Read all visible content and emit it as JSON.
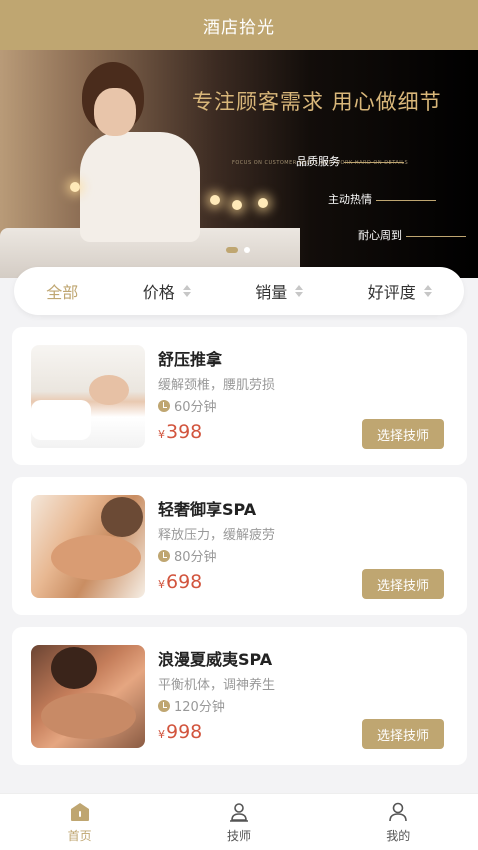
{
  "header": {
    "title": "酒店拾光"
  },
  "banner": {
    "headline": "专注顾客需求 用心做细节",
    "subline": "FOCUS ON CUSTOMER NEEDS AND WORK HARD ON DETAILS",
    "tags": [
      "品质服务",
      "主动热情",
      "耐心周到"
    ],
    "active_slide": 1,
    "slide_count": 2
  },
  "filters": [
    {
      "label": "全部",
      "active": true,
      "sortable": false
    },
    {
      "label": "价格",
      "active": false,
      "sortable": true
    },
    {
      "label": "销量",
      "active": false,
      "sortable": true
    },
    {
      "label": "好评度",
      "active": false,
      "sortable": true
    }
  ],
  "services": [
    {
      "name": "舒压推拿",
      "desc": "缓解颈椎，腰肌劳损",
      "duration": "60分钟",
      "currency": "¥",
      "price": "398",
      "button": "选择技师"
    },
    {
      "name": "轻奢御享SPA",
      "desc": "释放压力，缓解疲劳",
      "duration": "80分钟",
      "currency": "¥",
      "price": "698",
      "button": "选择技师"
    },
    {
      "name": "浪漫夏威夷SPA",
      "desc": "平衡机体，调神养生",
      "duration": "120分钟",
      "currency": "¥",
      "price": "998",
      "button": "选择技师"
    }
  ],
  "tabbar": [
    {
      "label": "首页",
      "icon": "home-icon",
      "active": true
    },
    {
      "label": "技师",
      "icon": "technician-icon",
      "active": false
    },
    {
      "label": "我的",
      "icon": "profile-icon",
      "active": false
    }
  ],
  "colors": {
    "accent": "#bfa671",
    "price": "#d2553e",
    "background": "#f3f3f5"
  }
}
